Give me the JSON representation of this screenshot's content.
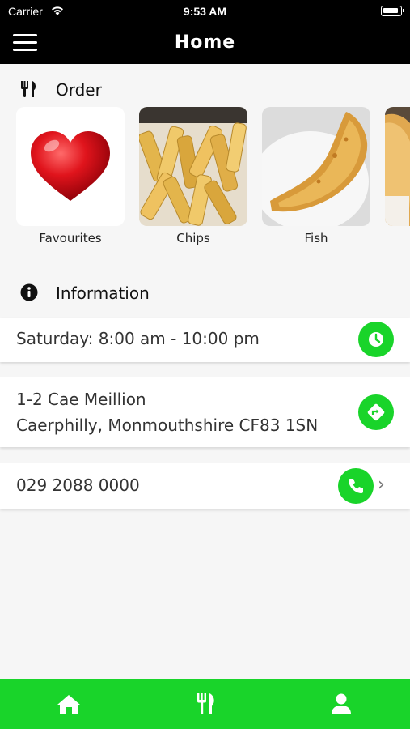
{
  "status_bar": {
    "carrier": "Carrier",
    "time": "9:53 AM"
  },
  "navbar": {
    "title": "Home"
  },
  "order_section": {
    "title": "Order",
    "icon": "utensils-icon"
  },
  "categories": [
    {
      "label": "Favourites",
      "icon": "heart-icon"
    },
    {
      "label": "Chips",
      "icon": "chips-photo"
    },
    {
      "label": "Fish",
      "icon": "fish-photo"
    },
    {
      "label": "",
      "icon": "pie-photo"
    }
  ],
  "info_section": {
    "title": "Information",
    "icon": "info-icon"
  },
  "hours": {
    "text": "Saturday: 8:00 am - 10:00 pm",
    "icon": "clock-icon"
  },
  "address": {
    "line1": "1-2 Cae Meillion",
    "line2": "Caerphilly, Monmouthshire CF83 1SN",
    "icon": "directions-icon"
  },
  "phone": {
    "text": "029 2088 0000",
    "icon": "phone-icon"
  },
  "tabs": [
    {
      "name": "home",
      "icon": "home-icon"
    },
    {
      "name": "menu",
      "icon": "utensils-icon"
    },
    {
      "name": "account",
      "icon": "user-icon"
    }
  ],
  "colors": {
    "accent": "#19d42a",
    "header": "#000000",
    "background": "#f6f6f6"
  }
}
